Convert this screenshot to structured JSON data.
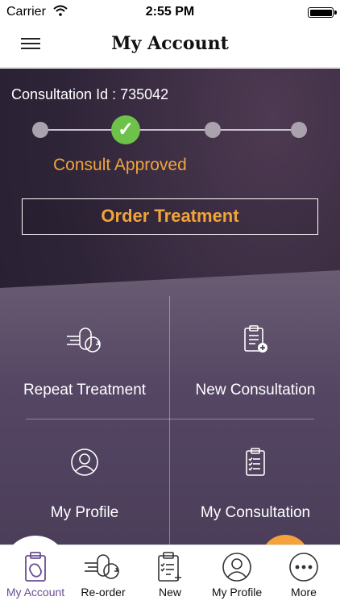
{
  "status_bar": {
    "carrier": "Carrier",
    "time": "2:55 PM"
  },
  "nav": {
    "title": "My Account",
    "menu_icon": "hamburger-menu-icon"
  },
  "consultation": {
    "id_text": "Consultation Id : 735042",
    "step_label": "Consult Approved",
    "steps_total": 4,
    "steps_completed": 2,
    "order_button": "Order Treatment"
  },
  "tiles": [
    {
      "label": "Repeat Treatment",
      "icon": "repeat-treatment-icon"
    },
    {
      "label": "New Consultation",
      "icon": "new-consultation-icon"
    },
    {
      "label": "My Profile",
      "icon": "profile-icon"
    },
    {
      "label": "My Consultation",
      "icon": "consultation-clipboard-icon"
    }
  ],
  "tabs": [
    {
      "label": "My Account",
      "icon": "account-clipboard-icon",
      "active": true
    },
    {
      "label": "Re-order",
      "icon": "reorder-icon"
    },
    {
      "label": "New",
      "icon": "new-clipboard-icon"
    },
    {
      "label": "My Profile",
      "icon": "profile-icon"
    },
    {
      "label": "More",
      "icon": "more-icon"
    }
  ],
  "colors": {
    "accent_orange": "#f0a43a",
    "check_green": "#6ec24a",
    "active_tab": "#6a4f92"
  }
}
